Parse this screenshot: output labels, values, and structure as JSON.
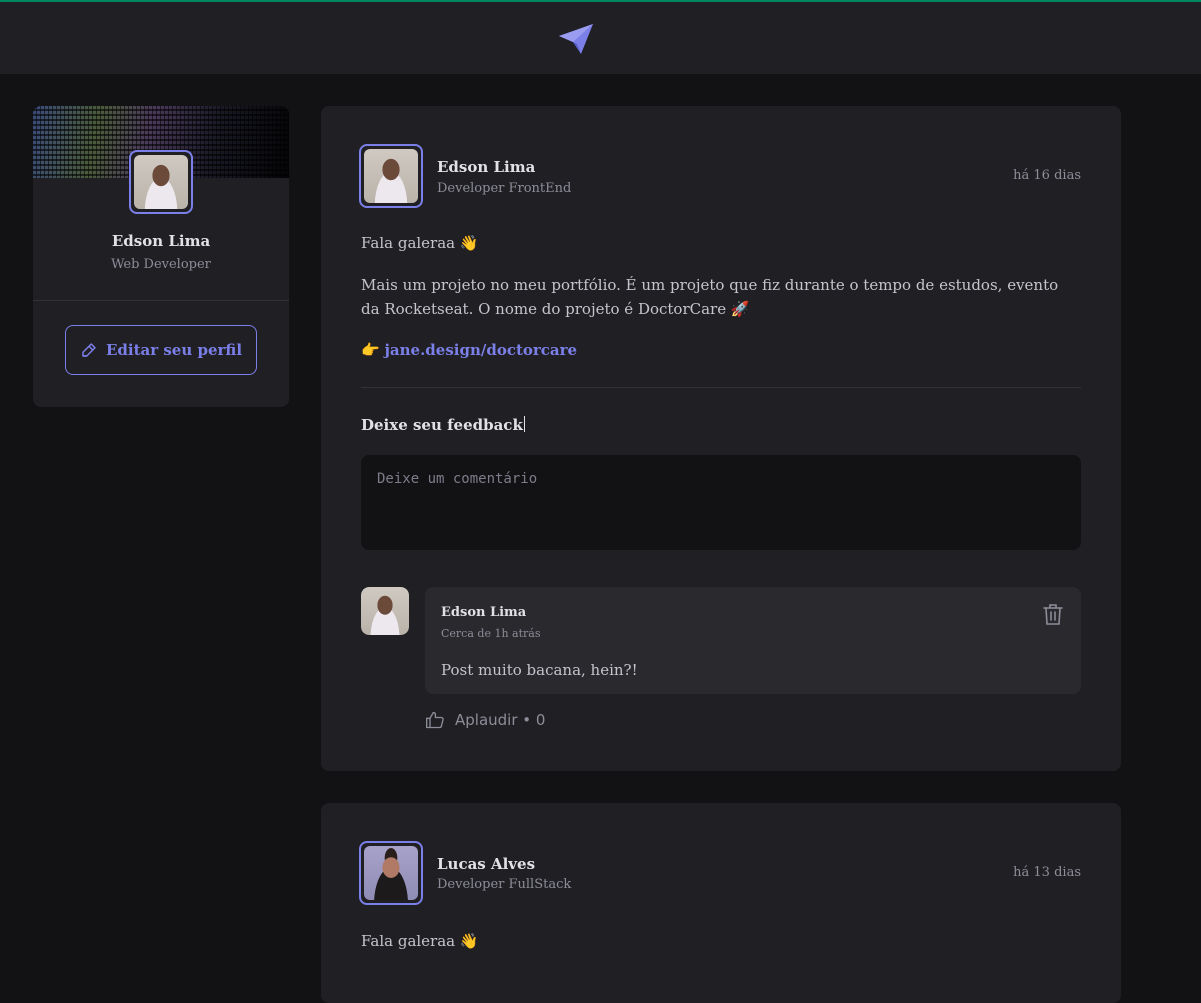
{
  "sidebar": {
    "name": "Edson Lima",
    "role": "Web Developer",
    "edit_label": "Editar seu perfil"
  },
  "posts": [
    {
      "author": "Edson Lima",
      "role": "Developer FrontEnd",
      "time": "há 16 dias",
      "greeting": "Fala galeraa 👋",
      "body": "Mais um projeto no meu portfólio. É um projeto que fiz durante o tempo de estudos, evento da Rocketseat. O nome do projeto é DoctorCare 🚀",
      "link_prefix": "👉",
      "link": "jane.design/doctorcare",
      "feedback_title": "Deixe seu feedback",
      "comment_placeholder": "Deixe um comentário",
      "comments": [
        {
          "author": "Edson Lima",
          "time": "Cerca de 1h atrás",
          "text": "Post muito bacana, hein?!",
          "applaud": "Aplaudir • 0"
        }
      ]
    },
    {
      "author": "Lucas Alves",
      "role": "Developer FullStack",
      "time": "há 13 dias",
      "greeting": "Fala galeraa 👋"
    }
  ],
  "colors": {
    "accent": "#7b7fe8",
    "background": "#121214",
    "surface": "#202024",
    "top_stripe": "#00875f"
  },
  "icons": {
    "logo": "paper-plane-logo",
    "edit": "pencil-icon",
    "trash": "trash-icon",
    "applaud": "thumbs-up-icon"
  }
}
